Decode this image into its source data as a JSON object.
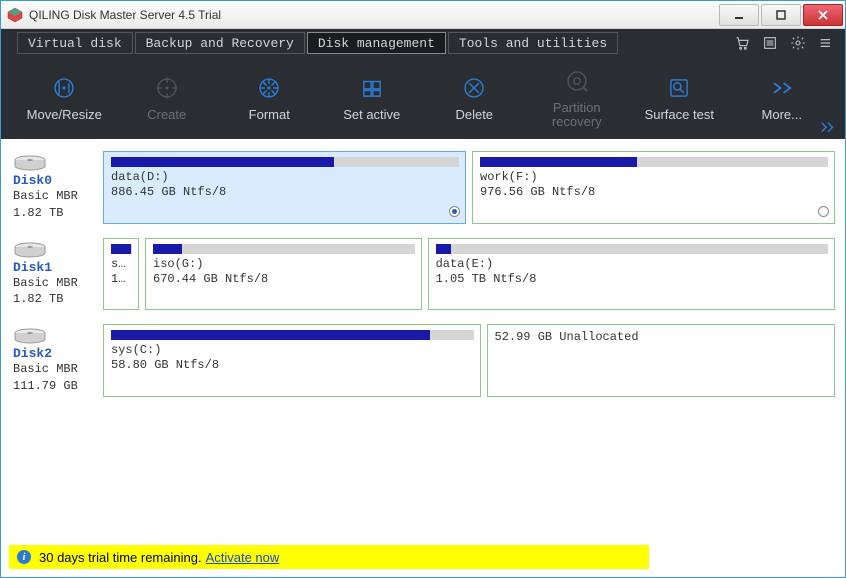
{
  "window_title": "QILING Disk Master Server 4.5 Trial",
  "tabs": [
    {
      "label": "Virtual disk",
      "active": false
    },
    {
      "label": "Backup and Recovery",
      "active": false
    },
    {
      "label": "Disk management",
      "active": true
    },
    {
      "label": "Tools and utilities",
      "active": false
    }
  ],
  "toolbar": [
    {
      "name": "move-resize",
      "label": "Move/Resize",
      "enabled": true
    },
    {
      "name": "create",
      "label": "Create",
      "enabled": false
    },
    {
      "name": "format",
      "label": "Format",
      "enabled": true
    },
    {
      "name": "set-active",
      "label": "Set active",
      "enabled": true
    },
    {
      "name": "delete",
      "label": "Delete",
      "enabled": true
    },
    {
      "name": "partition-recovery",
      "label": "Partition\nrecovery",
      "enabled": false
    },
    {
      "name": "surface-test",
      "label": "Surface test",
      "enabled": true
    },
    {
      "name": "more",
      "label": "More...",
      "enabled": true
    }
  ],
  "disks": [
    {
      "name": "Disk0",
      "type": "Basic MBR",
      "size": "1.82 TB",
      "partitions": [
        {
          "label": "data(D:)",
          "sub": "886.45 GB Ntfs/8",
          "fill": 64,
          "selected": true,
          "radio": true
        },
        {
          "label": "work(F:)",
          "sub": "976.56 GB Ntfs/8",
          "fill": 45,
          "selected": false,
          "radio": true
        }
      ]
    },
    {
      "name": "Disk1",
      "type": "Basic MBR",
      "size": "1.82 TB",
      "partitions": [
        {
          "label": "s...",
          "sub": "1...",
          "fill": 95,
          "selected": false,
          "radio": false,
          "w": 36
        },
        {
          "label": "iso(G:)",
          "sub": "670.44 GB Ntfs/8",
          "fill": 11,
          "selected": false,
          "radio": false
        },
        {
          "label": "data(E:)",
          "sub": "1.05 TB Ntfs/8",
          "fill": 4,
          "selected": false,
          "radio": false
        }
      ]
    },
    {
      "name": "Disk2",
      "type": "Basic MBR",
      "size": "111.79 GB",
      "partitions": [
        {
          "label": "sys(C:)",
          "sub": "58.80 GB Ntfs/8",
          "fill": 88,
          "selected": false,
          "radio": false
        },
        {
          "label": "52.99 GB Unallocated",
          "sub": "",
          "fill": null,
          "selected": false,
          "radio": false
        }
      ]
    }
  ],
  "layout": {
    "rows": [
      [
        {
          "flex": 1
        },
        {
          "flex": 1
        }
      ],
      [
        {
          "w": 36
        },
        {
          "flex": 1
        },
        {
          "flex": 1.5
        }
      ],
      [
        {
          "flex": 1
        },
        {
          "flex": 0.92
        }
      ]
    ]
  },
  "status": {
    "text": "30 days trial time remaining.",
    "link": "Activate now"
  }
}
